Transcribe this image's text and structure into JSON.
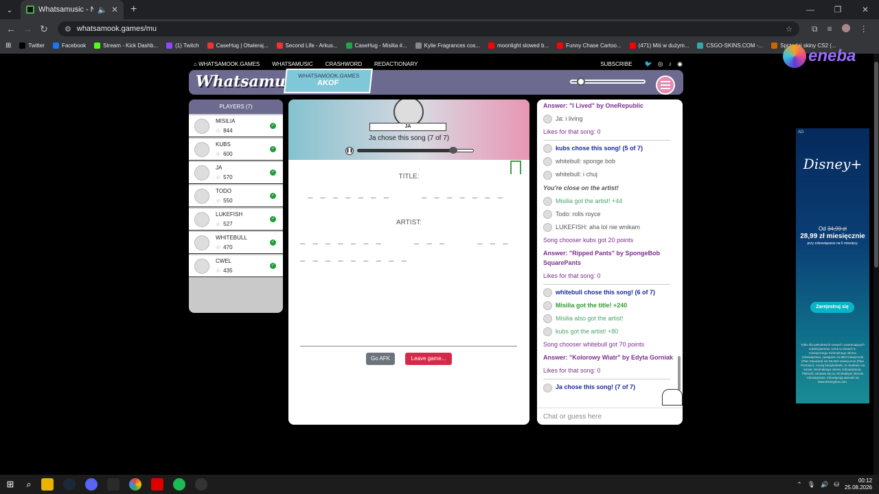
{
  "browser": {
    "tab_title": "Whatsamusic - Name That",
    "url": "whatsamook.games/mu",
    "bookmarks": [
      {
        "label": "Twitter",
        "color": "#000000"
      },
      {
        "label": "Facebook",
        "color": "#1877f2"
      },
      {
        "label": "Stream - Kick Dashb...",
        "color": "#53fc18"
      },
      {
        "label": "(1) Twitch",
        "color": "#9146ff"
      },
      {
        "label": "CaseHug | Otwieraj...",
        "color": "#e33"
      },
      {
        "label": "Second Life - Arkus...",
        "color": "#e33"
      },
      {
        "label": "CaseHug - Misilia #...",
        "color": "#22a34a"
      },
      {
        "label": "Kylie Fragrances cos...",
        "color": "#888"
      },
      {
        "label": "moonlight slowed b...",
        "color": "#f00"
      },
      {
        "label": "Funny Chase Cartoo...",
        "color": "#f00"
      },
      {
        "label": "(471) Miś w dużym...",
        "color": "#f00"
      },
      {
        "label": "CSGO-SKINS.COM -...",
        "color": "#3aa"
      },
      {
        "label": "Sprzedaj skiny CS2 (...",
        "color": "#c60"
      }
    ]
  },
  "site_nav": {
    "home": "WHATSAMOOK.GAMES",
    "whatsamusic": "WHATSAMUSIC",
    "crashword": "CRASHWORD",
    "redactionary": "REDACTIONARY",
    "subscribe": "SUBSCRIBE"
  },
  "header": {
    "logo": "Whatsamusic",
    "room_site": "WHATSAMOOK.GAMES",
    "room_code": "AKOF",
    "volume_level": 0.08
  },
  "players": {
    "title": "PLAYERS (7)",
    "list": [
      {
        "name": "MISILIA",
        "score": "844"
      },
      {
        "name": "KUBS",
        "score": "600"
      },
      {
        "name": "JA",
        "score": "570"
      },
      {
        "name": "TODO",
        "score": "550"
      },
      {
        "name": "LUKEFISH",
        "score": "527"
      },
      {
        "name": "WHITEBULL",
        "score": "470"
      },
      {
        "name": "CWEL",
        "score": "435"
      }
    ]
  },
  "game": {
    "chooser": "JA",
    "status": "Ja chose this song (7 of 7)",
    "progress": 0.83,
    "title_label": "TITLE:",
    "title_blanks": "_ _ _ _ _ _ _     _ _ _ _ _ _ _     _ _ _",
    "artist_label": "ARTIST:",
    "artist_blanks_1": "_ _ _ _ _ _ _     _ _ _     _ _ _",
    "artist_blanks_2": "_ _ _ _ _ _ _ _ _",
    "afk_button": "Go AFK",
    "leave_button": "Leave game..."
  },
  "chat": {
    "messages": [
      {
        "type": "purple",
        "text": "Answer: \"I Lived\" by OneRepublic"
      },
      {
        "type": "gray-av",
        "text": "Ja: i living"
      },
      {
        "type": "purple2",
        "text": "Likes for that song: 0"
      },
      {
        "type": "navy-av",
        "text": "kubs chose this song! (5 of 7)"
      },
      {
        "type": "gray-av",
        "text": "whitebull: sponge bob"
      },
      {
        "type": "gray-av",
        "text": "whitebull: i chuj"
      },
      {
        "type": "ital",
        "text": "You're close on the artist!"
      },
      {
        "type": "green-av",
        "text": "Misilia got the artist! +44"
      },
      {
        "type": "gray-av",
        "text": "Todo: rolls royce"
      },
      {
        "type": "gray-av",
        "text": "LUKEFISH: aha lol nie wnikam"
      },
      {
        "type": "purple2",
        "text": "Song chooser kubs got 20 points"
      },
      {
        "type": "purple",
        "text": "Answer: \"Ripped Pants\" by SpongeBob SquarePants"
      },
      {
        "type": "purple2",
        "text": "Likes for that song: 0"
      },
      {
        "type": "navy-av",
        "text": "whitebull chose this song! (6 of 7)"
      },
      {
        "type": "greenb-av",
        "text": "Misilia got the title! +240"
      },
      {
        "type": "green-av",
        "text": "Misilia also got the artist!"
      },
      {
        "type": "green-av",
        "text": "kubs got the artist! +80"
      },
      {
        "type": "purple2",
        "text": "Song chooser whitebull got 70 points"
      },
      {
        "type": "purple",
        "text": "Answer: \"Kolorowy Wiatr\" by Edyta Gorniak"
      },
      {
        "type": "purple2",
        "text": "Likes for that song: 0"
      },
      {
        "type": "navy-av",
        "text": "Ja chose this song! (7 of 7)"
      }
    ],
    "input_placeholder": "Chat or guess here"
  },
  "ad": {
    "tag": "AD",
    "brand": "Disney+",
    "from_label": "Od",
    "old_price": "34,99 zł",
    "price": "28,99 zł miesięcznie",
    "commitment": "przy zobowiązaniu na 6 miesięcy.",
    "cta": "Zarejestruj się",
    "legal": "Tylko dla pełnoletnich nowych i powracających subskrybentów. Cena w ramach 6-miesięcznego minimalnego okresu zobowiązania, następnie 34,99zł miesięcznie (Plan Standard) lub 59,99zł miesięcznie (Plan Premium). Anuluj kiedykolwiek, ze skutkiem na koniec minimalnego okresu zobowiązania. Płatność odnawia się po minimalnym okresie zobowiązania. Obowiązują warunki na www.disneyplus.com."
  },
  "overlay_brand": "eneba",
  "taskbar": {
    "time": "00:12",
    "date": "25.08.2026"
  }
}
